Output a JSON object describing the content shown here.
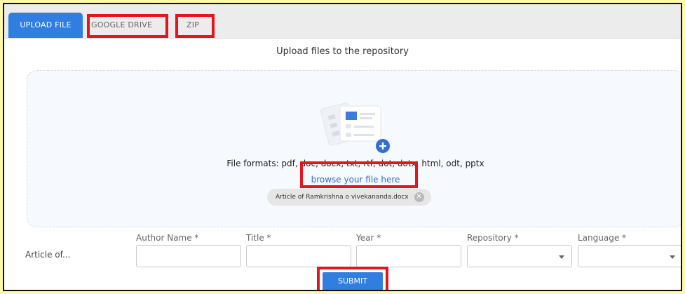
{
  "tabs": [
    {
      "label": "UPLOAD FILE",
      "active": true
    },
    {
      "label": "GOOGLE DRIVE",
      "active": false
    },
    {
      "label": "ZIP",
      "active": false
    }
  ],
  "heading": "Upload files to the repository",
  "dropzone": {
    "formats_text": "File formats: pdf, doc, docx, txt, rtf, dot, dotx, html, odt, pptx",
    "browse_text": "browse your file here",
    "file_chip": "Article of Ramkrishna o vivekananda.docx"
  },
  "form": {
    "row_label": "Article of...",
    "fields": {
      "author": {
        "label": "Author Name *",
        "value": ""
      },
      "title": {
        "label": "Title *",
        "value": ""
      },
      "year": {
        "label": "Year *",
        "value": ""
      },
      "repository": {
        "label": "Repository *",
        "value": ""
      },
      "language": {
        "label": "Language *",
        "value": ""
      }
    },
    "submit_label": "SUBMIT"
  },
  "colors": {
    "accent": "#2f7ee0",
    "highlight": "#e8141b",
    "background": "#fff9a8"
  },
  "icons": [
    "document-upload-illustration",
    "plus-circle-icon",
    "remove-chip-icon",
    "dropdown-arrow-icon"
  ]
}
